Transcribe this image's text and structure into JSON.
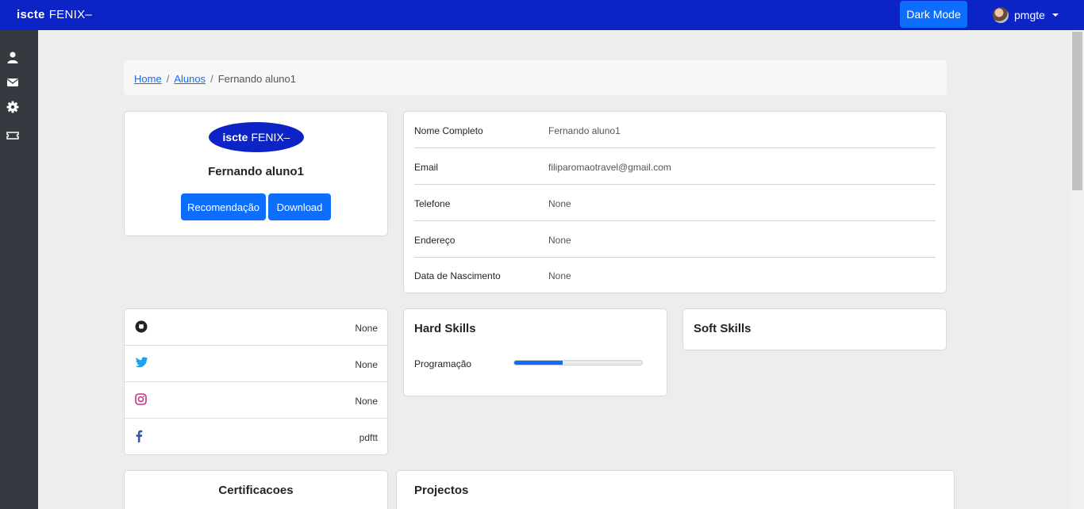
{
  "topbar": {
    "brand_part1": "iscte",
    "brand_part2": "FENIX–",
    "dark_mode_label": "Dark Mode",
    "user_name": "pmgte"
  },
  "sidebar": {
    "icons": [
      "user-icon",
      "envelope-icon",
      "gear-icon",
      "ticket-icon"
    ]
  },
  "breadcrumb": {
    "items": [
      "Home",
      "Alunos",
      "Fernando aluno1"
    ],
    "separator": "/"
  },
  "profile": {
    "logo_part1": "iscte",
    "logo_part2": "FENIX–",
    "name": "Fernando aluno1",
    "recommend_label": "Recomendação",
    "download_label": "Download"
  },
  "details": {
    "rows": [
      {
        "label": "Nome Completo",
        "value": "Fernando aluno1"
      },
      {
        "label": "Email",
        "value": "filiparomaotravel@gmail.com"
      },
      {
        "label": "Telefone",
        "value": "None"
      },
      {
        "label": "Endereço",
        "value": "None"
      },
      {
        "label": "Data de Nascimento",
        "value": "None"
      }
    ]
  },
  "social": {
    "rows": [
      {
        "icon": "github-icon",
        "value": "None"
      },
      {
        "icon": "twitter-icon",
        "value": "None"
      },
      {
        "icon": "instagram-icon",
        "value": "None"
      },
      {
        "icon": "facebook-icon",
        "value": "pdftt"
      }
    ]
  },
  "hard_skills": {
    "title": "Hard Skills",
    "skills": [
      {
        "name": "Programação",
        "progress_percent": 38
      }
    ]
  },
  "soft_skills": {
    "title": "Soft Skills"
  },
  "certificacoes": {
    "title": "Certificacoes"
  },
  "projectos": {
    "title": "Projectos"
  },
  "colors": {
    "topbar": "#0c24c6",
    "primary": "#0d6efd",
    "sidebar": "#343a40",
    "background": "#ededed",
    "twitter": "#1da1f2",
    "instagram": "#c13584",
    "facebook": "#3b5998"
  }
}
